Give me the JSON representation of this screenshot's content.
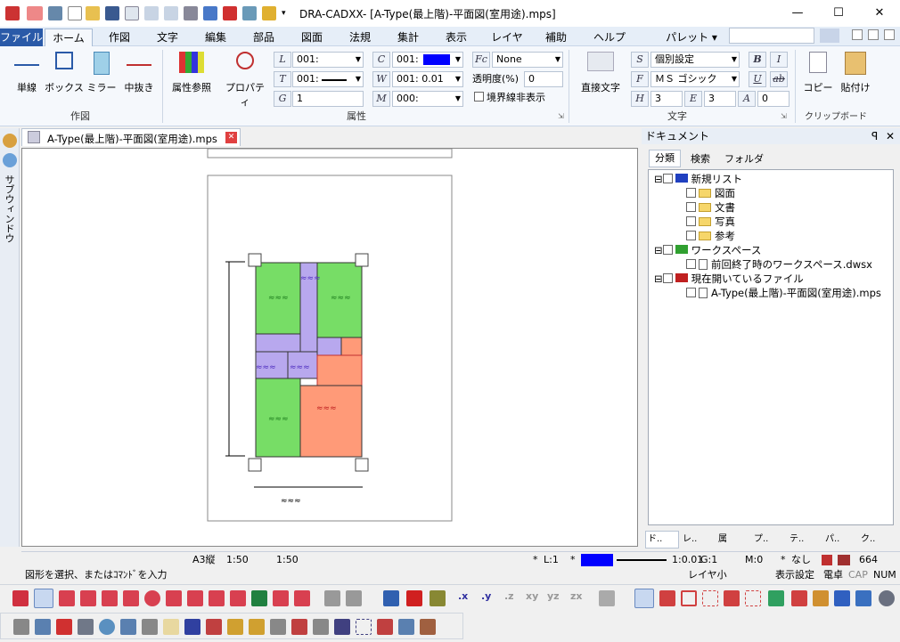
{
  "window": {
    "title": "DRA-CADXX- [A-Type(最上階)-平面図(室用途).mps]",
    "minimize": "—",
    "maximize": "☐",
    "close": "✕"
  },
  "menu": {
    "file": "ファイル",
    "tabs": [
      "ホーム",
      "作図",
      "文字",
      "編集",
      "部品",
      "図面",
      "法規",
      "集計",
      "表示",
      "レイヤ",
      "補助",
      "ヘルプ"
    ],
    "palette": "パレット ▾"
  },
  "ribbon": {
    "draw_group": {
      "label": "作図",
      "buttons": [
        "単線",
        "ボックス",
        "ミラー",
        "中抜き"
      ]
    },
    "attr_group": {
      "label": "属性",
      "buttons": [
        "属性参照",
        "プロパティ"
      ],
      "layer": "001:",
      "line_type": "001:",
      "group": "1",
      "color": "001:",
      "line_width": "001: 0.01",
      "hatch": "000:",
      "fill": "None",
      "transparency_label": "透明度(%)",
      "transparency": "0",
      "hide_border_label": "境界線非表示",
      "color_swatch": "#0000ff"
    },
    "text_group": {
      "label": "文字",
      "direct_text": "直接文字",
      "style": "個別設定",
      "font": "ＭＳ ゴシック",
      "height": "3",
      "width": "3",
      "angle": "0"
    },
    "clip_group": {
      "label": "クリップボード",
      "copy": "コピー",
      "paste": "貼付け"
    }
  },
  "document_tab": {
    "label": "A-Type(最上階)-平面図(室用途).mps"
  },
  "left_strip": {
    "label": "サブウィンドウ"
  },
  "right_panel": {
    "title": "ドキュメント",
    "tabs": [
      "分類",
      "検索",
      "フォルダ"
    ],
    "tree": [
      {
        "label": "新規リスト",
        "level": 0
      },
      {
        "label": "図面",
        "level": 1
      },
      {
        "label": "文書",
        "level": 1
      },
      {
        "label": "写真",
        "level": 1
      },
      {
        "label": "参考",
        "level": 1
      },
      {
        "label": "ワークスペース",
        "level": 0
      },
      {
        "label": "前回終了時のワークスペース.dwsx",
        "level": 1
      },
      {
        "label": "現在開いているファイル",
        "level": 0
      },
      {
        "label": "A-Type(最上階)-平面図(室用途).mps",
        "level": 1
      }
    ],
    "bottom_tabs": [
      "ド..",
      "レ..",
      "属",
      "プ..",
      "テ..",
      "パ..",
      "ク.."
    ]
  },
  "status": {
    "paper": "A3縦",
    "scale1": "1:50",
    "scale2": "1:50",
    "layer": "L:1",
    "line_scale": "1:0.01",
    "group": "G:1",
    "mode": "M:0",
    "none": "なし",
    "count": "664",
    "prompt": "図形を選択、またはｺﾏﾝﾄﾞを入力",
    "layer_small": "レイヤ小",
    "display_settings": "表示設定",
    "calc": "電卓",
    "cap": "CAP",
    "num": "NUM",
    "star": "*"
  },
  "plan": {
    "green": "#77dd66",
    "purple": "#b8a8ee",
    "red": "#ff9a78",
    "room_labels": [
      "≈≈≈",
      "≈≈≈",
      "≈≈≈",
      "≈≈≈",
      "≈≈≈",
      "≈≈≈",
      "≈≈≈",
      "≈≈≈"
    ]
  }
}
